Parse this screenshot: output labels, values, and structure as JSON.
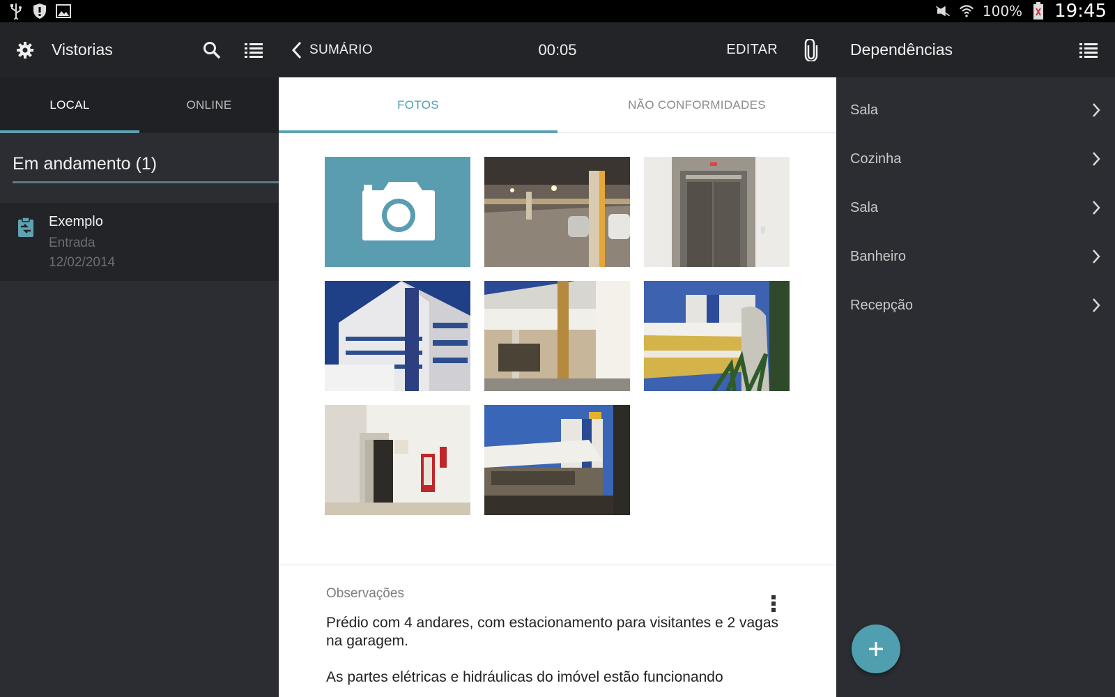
{
  "status_bar": {
    "left_icons": [
      "usb-icon",
      "shield-icon",
      "image-icon"
    ],
    "right_icons": [
      "mute-icon",
      "wifi-icon",
      "battery-icon"
    ],
    "battery": "100%",
    "time": "19:45"
  },
  "left_pane": {
    "title": "Vistorias",
    "icons": [
      "gear-icon",
      "search-icon",
      "list-icon"
    ],
    "tabs": [
      {
        "label": "LOCAL",
        "active": true
      },
      {
        "label": "ONLINE",
        "active": false
      }
    ],
    "section_title": "Em andamento (1)",
    "items": [
      {
        "title": "Exemplo",
        "subtitle": "Entrada",
        "date": "12/02/2014",
        "icon": "clipboard-icon"
      }
    ]
  },
  "middle_pane": {
    "back_label": "SUMÁRIO",
    "timer": "00:05",
    "edit_label": "EDITAR",
    "attach_icon": "paperclip-icon",
    "tabs": [
      {
        "label": "FOTOS",
        "active": true
      },
      {
        "label": "NÃO CONFORMIDADES",
        "active": false
      }
    ],
    "photos": [
      {
        "kind": "camera",
        "icon": "camera-icon"
      },
      {
        "kind": "photo",
        "subject": "garage"
      },
      {
        "kind": "photo",
        "subject": "elevator"
      },
      {
        "kind": "photo",
        "subject": "building-facade"
      },
      {
        "kind": "photo",
        "subject": "building-columns"
      },
      {
        "kind": "photo",
        "subject": "building-sign"
      },
      {
        "kind": "photo",
        "subject": "entrance-door"
      },
      {
        "kind": "photo",
        "subject": "building-street"
      }
    ],
    "observations_label": "Observações",
    "observations_text_1": "Prédio com 4 andares, com estacionamento para visitantes e 2 vagas na garagem.",
    "observations_text_2": "As partes elétricas e hidráulicas do imóvel estão funcionando"
  },
  "right_pane": {
    "title": "Dependências",
    "items": [
      "Sala",
      "Cozinha",
      "Sala",
      "Banheiro",
      "Recepção"
    ],
    "fab_icon": "plus-icon"
  },
  "colors": {
    "accent": "#5fa3b3",
    "camera_tile": "#5a9db0",
    "header_bg": "#222428",
    "pane_bg": "#2b2d32"
  }
}
